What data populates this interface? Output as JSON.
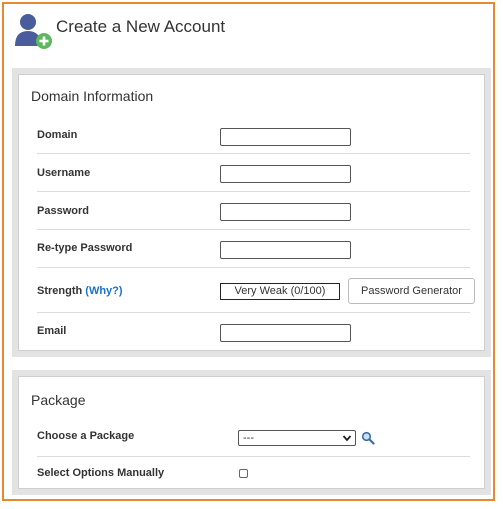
{
  "header": {
    "title": "Create a New Account",
    "icon": "user-add-icon"
  },
  "domain_section": {
    "title": "Domain Information",
    "fields": {
      "domain": {
        "label": "Domain",
        "value": ""
      },
      "username": {
        "label": "Username",
        "value": ""
      },
      "password": {
        "label": "Password",
        "value": ""
      },
      "retype": {
        "label": "Re-type Password",
        "value": ""
      },
      "strength": {
        "label": "Strength",
        "why_link": "(Why?)",
        "meter": "Very Weak (0/100)",
        "generator_button": "Password Generator"
      },
      "email": {
        "label": "Email",
        "value": ""
      }
    }
  },
  "package_section": {
    "title": "Package",
    "choose_label": "Choose a Package",
    "choose_value": "---",
    "manual_label": "Select Options Manually",
    "manual_checked": false
  },
  "colors": {
    "border_accent": "#e8892f",
    "link": "#1a73c8",
    "icon_user": "#4a5c9c",
    "icon_plus": "#5cb85c",
    "panel_bg": "#e3e3e3"
  }
}
